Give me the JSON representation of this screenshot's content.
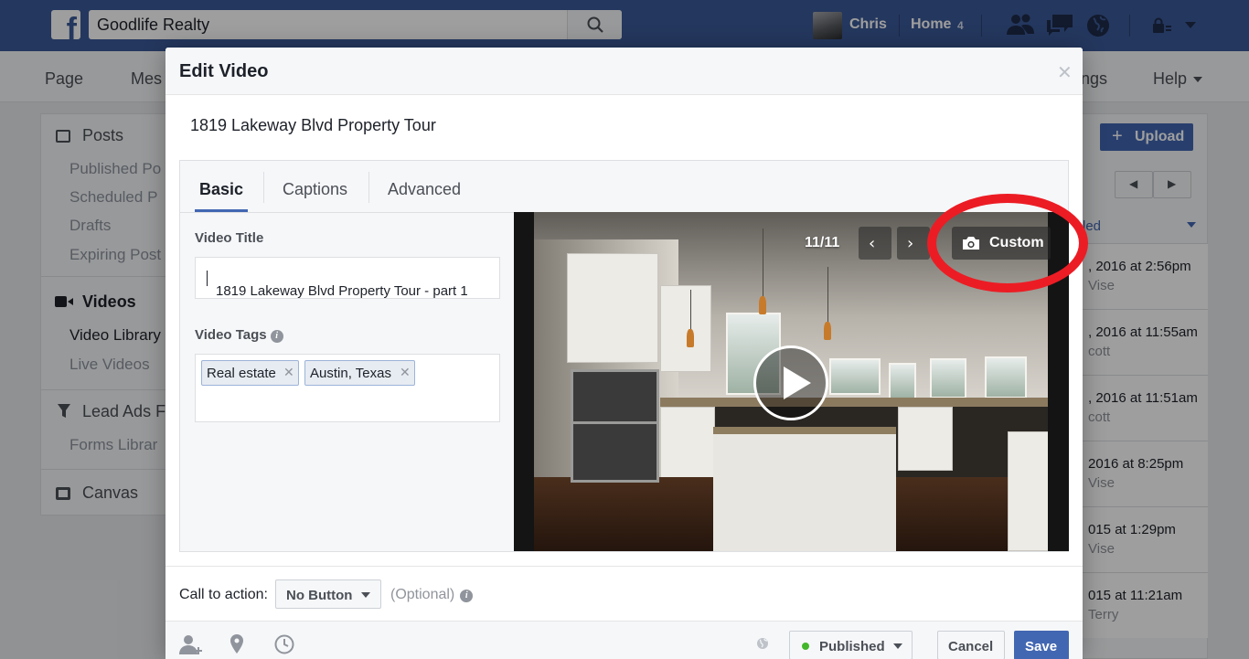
{
  "topbar": {
    "search_value": "Goodlife Realty",
    "user_name": "Chris",
    "home_label": "Home",
    "home_count": "4",
    "brand_color": "#3b5998"
  },
  "page_tabs": [
    "Page",
    "Mes",
    "ngs",
    "Help"
  ],
  "sidebar": {
    "posts_heading": "Posts",
    "posts_items": [
      "Published Po",
      "Scheduled P",
      "Drafts",
      "Expiring Post"
    ],
    "videos_heading": "Videos",
    "videos_items": [
      "Video Library",
      "Live Videos"
    ],
    "leads_heading": "Lead Ads F",
    "leads_items": [
      "Forms Librar"
    ],
    "canvas_heading": "Canvas"
  },
  "right_panel": {
    "upload_label": "Upload",
    "sort_label": "led",
    "rows": [
      {
        "date": ", 2016 at 2:56pm",
        "name": "Vise"
      },
      {
        "date": ", 2016 at 11:55am",
        "name": "cott"
      },
      {
        "date": ", 2016 at 11:51am",
        "name": "cott"
      },
      {
        "date": "2016 at 8:25pm",
        "name": "Vise"
      },
      {
        "date": "015 at 1:29pm",
        "name": "Vise"
      },
      {
        "date": "015 at 11:21am",
        "name": "Terry"
      }
    ]
  },
  "modal": {
    "title": "Edit Video",
    "video_name": "1819 Lakeway Blvd Property Tour",
    "tabs": [
      "Basic",
      "Captions",
      "Advanced"
    ],
    "video_title_label": "Video Title",
    "video_title_value": "1819 Lakeway Blvd Property Tour - part 1",
    "video_tags_label": "Video Tags",
    "tags": [
      "Real estate",
      "Austin, Texas"
    ],
    "thumb_counter": "11/11",
    "custom_label": "Custom",
    "cta_label": "Call to action:",
    "cta_value": "No Button",
    "optional_label": "(Optional)",
    "published_label": "Published",
    "cancel_label": "Cancel",
    "save_label": "Save",
    "accent_color": "#4267b2",
    "highlight_color": "#ec1c24"
  }
}
